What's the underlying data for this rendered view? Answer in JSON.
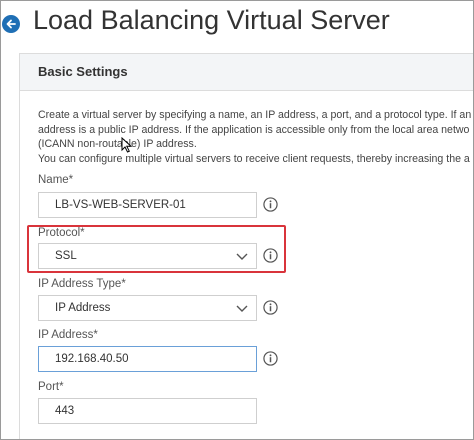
{
  "header": {
    "title": "Load Balancing Virtual Server",
    "back_icon": "arrow-left-circle-icon"
  },
  "section": {
    "title": "Basic Settings"
  },
  "description": {
    "lines": [
      "Create a virtual server by specifying a name, an IP address, a port, and a protocol type. If an",
      "address is a public IP address. If the application is accessible only from the local area netwo",
      "(ICANN non-routable) IP address.",
      "You can configure multiple virtual servers to receive client requests, thereby increasing the a"
    ]
  },
  "form": {
    "name": {
      "label": "Name*",
      "value": "LB-VS-WEB-SERVER-01"
    },
    "protocol": {
      "label": "Protocol*",
      "value": "SSL"
    },
    "ip_address_type": {
      "label": "IP Address Type*",
      "value": "IP Address"
    },
    "ip_address": {
      "label": "IP Address*",
      "value": "192.168.40.50"
    },
    "port": {
      "label": "Port*",
      "value": "443"
    }
  },
  "colors": {
    "accent": "#1f6fb5",
    "highlight": "#d9343b",
    "header_bg": "#f3f5f7"
  }
}
